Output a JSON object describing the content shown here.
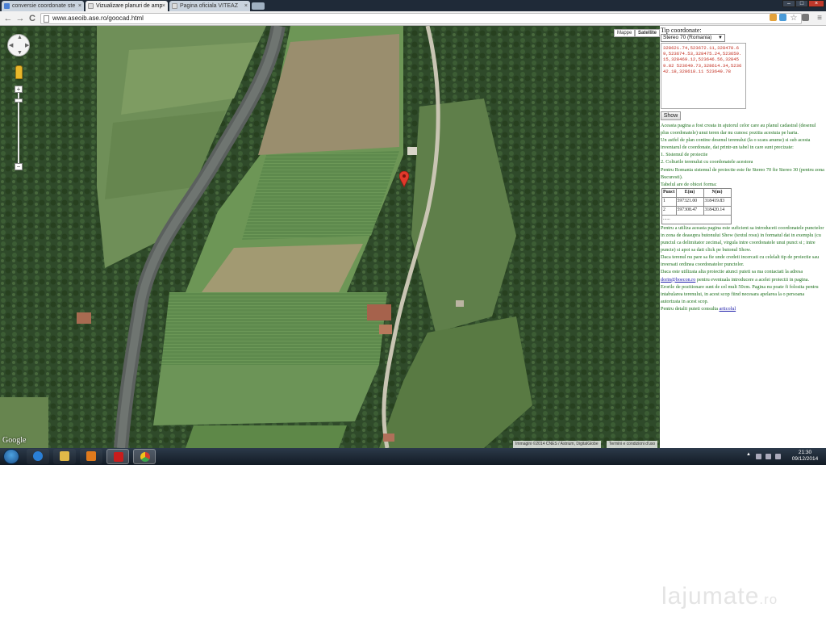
{
  "browser": {
    "tabs": [
      {
        "title": "conversie coordonate ste",
        "color": "#4a7fd4"
      },
      {
        "title": "Vizualizare planuri de amp",
        "color": "#dddddd"
      },
      {
        "title": "Pagina oficiala VITEAZ",
        "color": "#dddddd"
      }
    ],
    "close_glyph": "×",
    "url": "www.aseoib.ase.ro/goocad.html",
    "back_glyph": "←",
    "forward_glyph": "→",
    "reload_glyph": "C",
    "menu_glyph": "≡",
    "star_glyph": "☆",
    "window_controls": [
      "–",
      "□",
      "×"
    ]
  },
  "map": {
    "type_buttons": [
      "Mappe",
      "Satellite"
    ],
    "active_type": "Satellite",
    "zoom_in": "+",
    "zoom_out": "−",
    "logo": "Google",
    "attribution": "Immagini ©2014 CNES / Astrium, DigitalGlobe",
    "terms": "Termini e condizioni d'uso",
    "marker_color": "#e0392b"
  },
  "panel": {
    "label": "Tip coordonate:",
    "select_value": "Stereo 70 (Romania)",
    "textarea": "328621.74,523672.11,328470.69,523674.53,328475.24,523659.15,328469.12,523646.56,328459.82 523640.73,328614.34,523642.18,328618.11 523649.78",
    "show_button": "Show",
    "paragraphs": [
      "Aceasta pagina a fost creata in ajutorul celor care au planul cadastral (desenul plus coordonatele) unui teren dar nu cunosc pozitia acestuia pe harta.",
      "Un astfel de plan contine desenul terenului (la o scara anume) si sub acesta inventarul de coordonate, dat printr-un tabel in care sunt precizate:",
      "1. Sistemul de proiectie",
      "2. Colturile terenului cu coordonatele acestora",
      "Pentru Romania sistemul de proiectie este fie Stereo 70 fie Stereo 30 (pentru zona Bucuresti).",
      "Tabelul are de obicei forma:"
    ],
    "table": {
      "headers": [
        "Punct",
        "E(m)",
        "N(m)"
      ],
      "rows": [
        [
          "1",
          "597321.00",
          "318419.83"
        ],
        [
          "2",
          "597308.47",
          "318420.14"
        ]
      ],
      "ellipsis": "......"
    },
    "after_table": [
      "Pentru a utiliza aceasta pagina este suficient sa introduceti coordonatele punctelor in zona de deasupra butonului Show (textul rosu) in formatul dat in exemplu (cu punctul ca delimitator zecimal, virgula intre coordonatele unui punct si ; intre puncte) si apoi sa dati click pe butonul Show.",
      "Daca terenul nu pare sa fie unde credeti incercati cu celelalt tip de proiectie sau inversati ordinea coordonatelor punctelor.",
      "Erorile de pozitionare sunt de cel mult 50cm. Pagina nu poate fi folosita pentru intabularea terenului, in acest scop fiind necesara apelarea la o persoana autorizata in acest scop."
    ],
    "contact_pre": "Daca este utilizata alta proiectie atunci puteti sa ma contactati la adresa ",
    "contact_link": "dorin@boecon.ro",
    "contact_post": " pentru eventuala introducere a acelei proiectii in pagina.",
    "details_pre": "Pentru detalii puteti consulta ",
    "details_link": "articolul"
  },
  "taskbar": {
    "time": "21:30",
    "date": "09/12/2014",
    "apps": [
      {
        "name": "internet-explorer",
        "color": "#2a7fd6"
      },
      {
        "name": "file-explorer",
        "color": "#e0b848"
      },
      {
        "name": "media-player",
        "color": "#e07a1c"
      },
      {
        "name": "adobe-reader",
        "color": "#c81d1d"
      },
      {
        "name": "chrome",
        "color": "#3aa54a"
      }
    ]
  },
  "watermark": {
    "text": "lajumate",
    "suffix": ".ro"
  }
}
